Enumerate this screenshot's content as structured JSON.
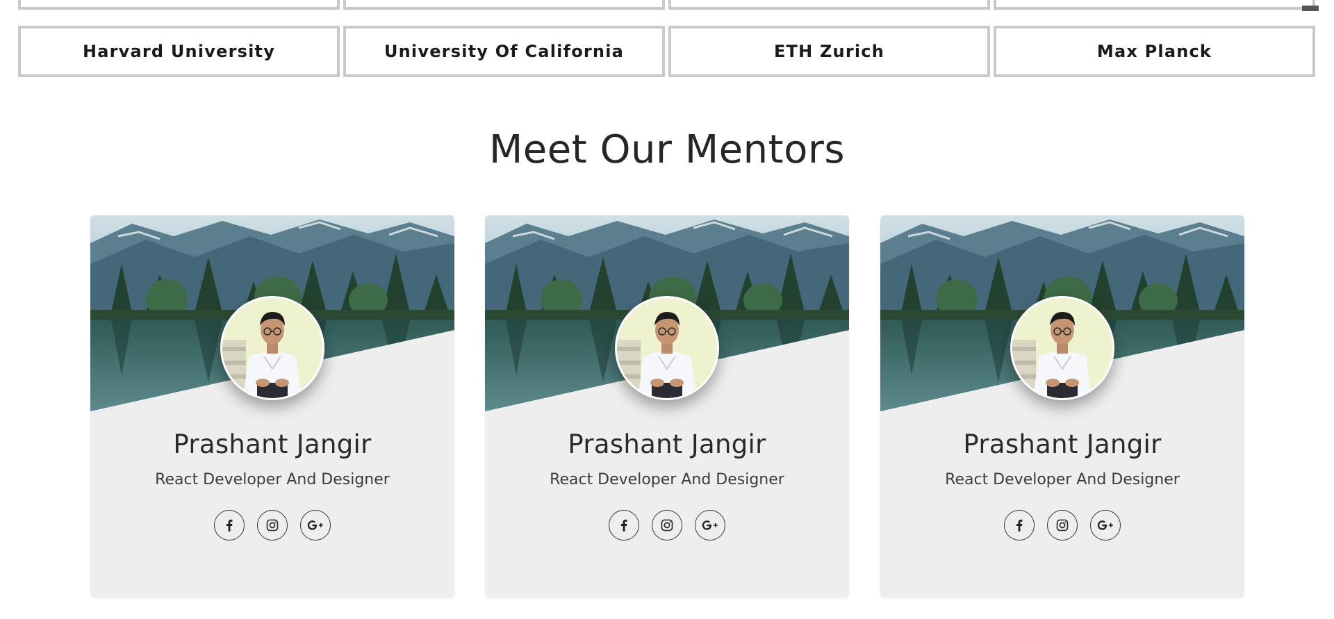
{
  "universities": [
    {
      "name": "Harvard University"
    },
    {
      "name": "University Of California"
    },
    {
      "name": "ETH Zurich"
    },
    {
      "name": "Max Planck"
    }
  ],
  "mentors_section": {
    "title": "Meet Our Mentors",
    "cards": [
      {
        "name": "Prashant Jangir",
        "role": "React Developer And Designer",
        "socials": [
          "facebook-icon",
          "instagram-icon",
          "google-plus-icon"
        ]
      },
      {
        "name": "Prashant Jangir",
        "role": "React Developer And Designer",
        "socials": [
          "facebook-icon",
          "instagram-icon",
          "google-plus-icon"
        ]
      },
      {
        "name": "Prashant Jangir",
        "role": "React Developer And Designer",
        "socials": [
          "facebook-icon",
          "instagram-icon",
          "google-plus-icon"
        ]
      }
    ]
  },
  "colors": {
    "card_background": "#eeeeee",
    "box_border": "#c9c9c9",
    "text": "#222222"
  }
}
